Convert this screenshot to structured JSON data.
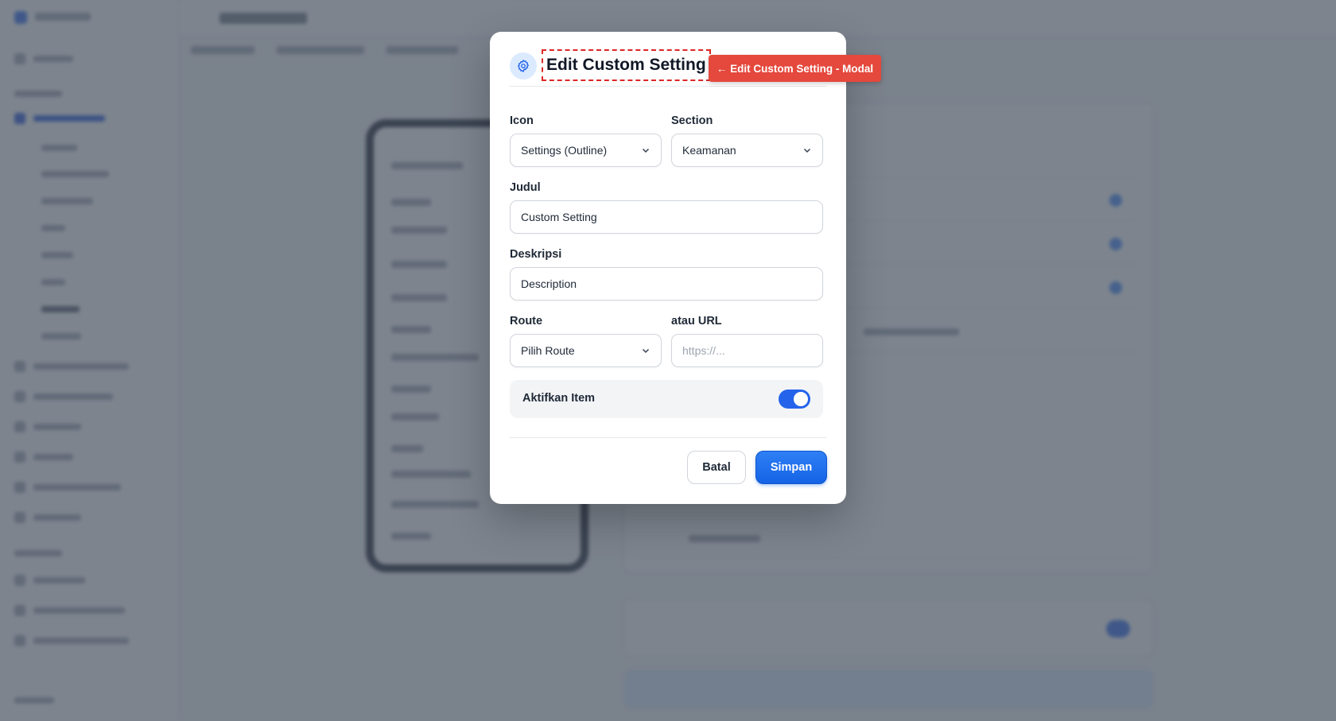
{
  "modal": {
    "title": "Edit Custom Setting",
    "fields": {
      "icon": {
        "label": "Icon",
        "value": "Settings (Outline)"
      },
      "section": {
        "label": "Section",
        "value": "Keamanan"
      },
      "judul": {
        "label": "Judul",
        "value": "Custom Setting"
      },
      "deskripsi": {
        "label": "Deskripsi",
        "value": "Description"
      },
      "route": {
        "label": "Route",
        "value": "Pilih Route"
      },
      "url": {
        "label": "atau URL",
        "placeholder": "https://..."
      }
    },
    "toggle": {
      "label": "Aktifkan Item",
      "enabled": true
    },
    "buttons": {
      "cancel": "Batal",
      "save": "Simpan"
    }
  },
  "annotation": {
    "text": "← Edit Custom Setting - Modal"
  },
  "colors": {
    "primary": "#2563eb",
    "annotation": "#e5483c",
    "overlay": "#4b5563"
  },
  "icons": {
    "header": "gear-icon",
    "dropdown": "chevron-down-icon"
  }
}
